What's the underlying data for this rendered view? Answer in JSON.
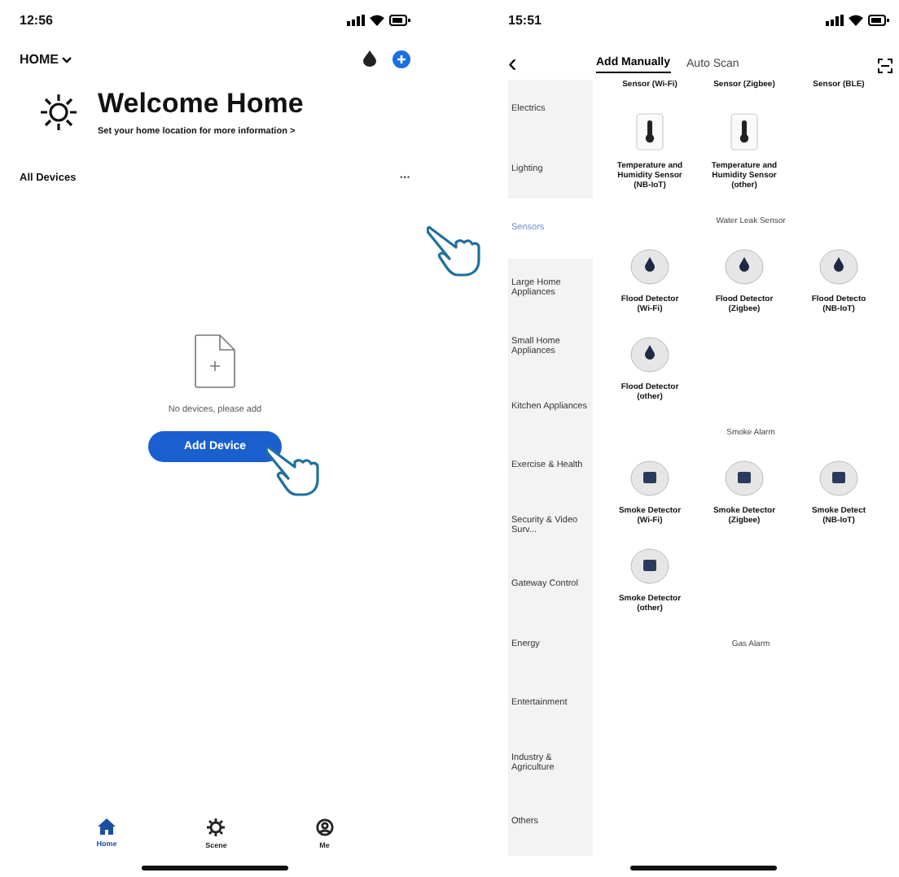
{
  "home_screen": {
    "status_bar": {
      "time": "12:56"
    },
    "home_selector": "HOME",
    "welcome": {
      "title": "Welcome Home",
      "subtitle": "Set your home location for more information >"
    },
    "section_title": "All Devices",
    "more": "···",
    "empty_message": "No devices, please add",
    "add_button": "Add Device",
    "tabs": [
      {
        "label": "Home",
        "selected": true
      },
      {
        "label": "Scene",
        "selected": false
      },
      {
        "label": "Me",
        "selected": false
      }
    ]
  },
  "add_screen": {
    "status_bar": {
      "time": "15:51"
    },
    "back": "‹",
    "tabs": [
      {
        "label": "Add Manually",
        "selected": true
      },
      {
        "label": "Auto Scan",
        "selected": false
      }
    ],
    "categories": [
      {
        "label": "Electrics",
        "selected": false
      },
      {
        "label": "Lighting",
        "selected": false
      },
      {
        "label": "Sensors",
        "selected": true
      },
      {
        "label": "Large Home Appliances",
        "selected": false
      },
      {
        "label": "Small Home Appliances",
        "selected": false
      },
      {
        "label": "Kitchen Appliances",
        "selected": false
      },
      {
        "label": "Exercise & Health",
        "selected": false
      },
      {
        "label": "Security & Video Surv...",
        "selected": false
      },
      {
        "label": "Gateway Control",
        "selected": false
      },
      {
        "label": "Energy",
        "selected": false
      },
      {
        "label": "Entertainment",
        "selected": false
      },
      {
        "label": "Industry & Agriculture",
        "selected": false
      },
      {
        "label": "Others",
        "selected": false
      }
    ],
    "sections": [
      {
        "devices": [
          {
            "kind": "text",
            "name": "Sensor (Wi-Fi)"
          },
          {
            "kind": "text",
            "name": "Sensor (Zigbee)"
          },
          {
            "kind": "text",
            "name": "Sensor (BLE)"
          },
          {
            "kind": "thermometer",
            "name": "Temperature and Humidity Sensor (NB-IoT)"
          },
          {
            "kind": "thermometer",
            "name": "Temperature and Humidity Sensor (other)"
          }
        ]
      },
      {
        "title": "Water Leak Sensor",
        "devices": [
          {
            "kind": "flood",
            "name": "Flood Detector (Wi-Fi)"
          },
          {
            "kind": "flood",
            "name": "Flood Detector (Zigbee)"
          },
          {
            "kind": "flood",
            "name": "Flood Detecto (NB-IoT)"
          },
          {
            "kind": "flood",
            "name": "Flood Detector (other)"
          }
        ]
      },
      {
        "title": "Smoke Alarm",
        "devices": [
          {
            "kind": "smoke",
            "name": "Smoke Detector (Wi-Fi)"
          },
          {
            "kind": "smoke",
            "name": "Smoke Detector (Zigbee)"
          },
          {
            "kind": "smoke",
            "name": "Smoke Detect (NB-IoT)"
          },
          {
            "kind": "smoke",
            "name": "Smoke Detector (other)"
          }
        ]
      },
      {
        "title": "Gas Alarm"
      }
    ]
  }
}
